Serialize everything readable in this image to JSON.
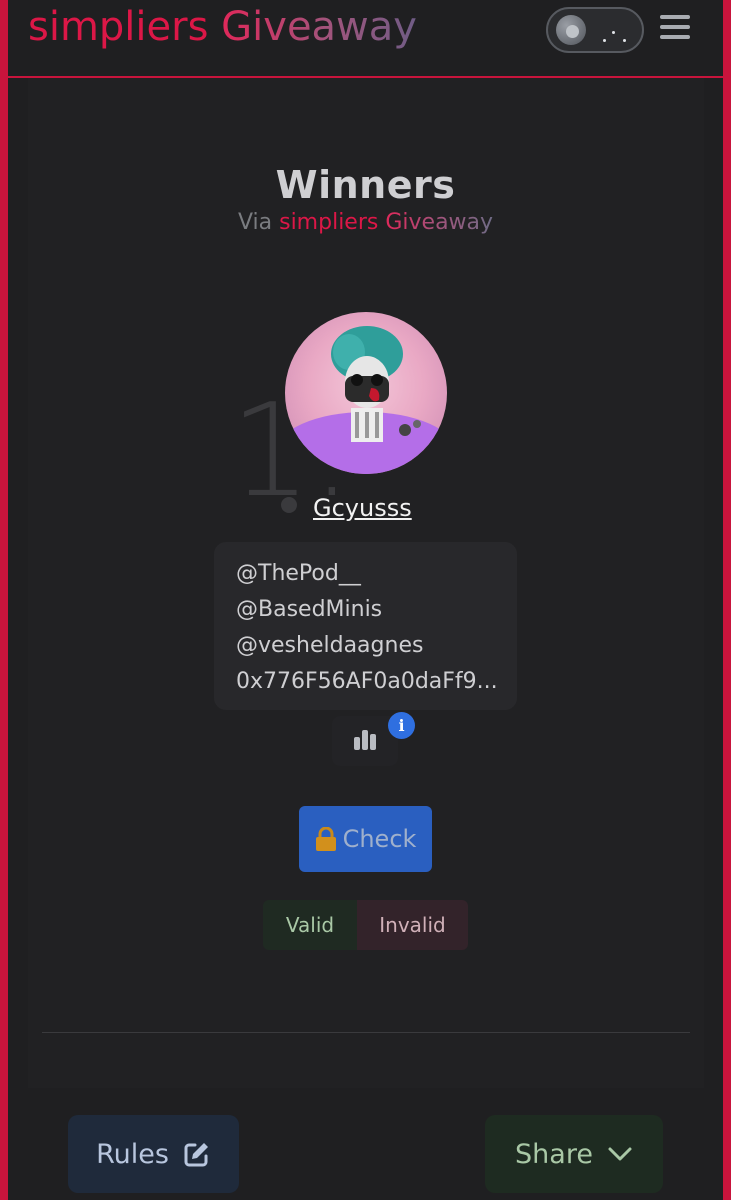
{
  "header": {
    "brand_part1": "simpliers",
    "brand_part2": "Giveaway",
    "theme_toggle_icon": "moon-toggle-icon",
    "menu_icon": "hamburger-menu-icon"
  },
  "main": {
    "title": "Winners",
    "via_prefix": "Via",
    "via_brand1": "simpliers",
    "via_brand2": "Giveaway"
  },
  "winners": [
    {
      "rank": "1.",
      "name": "Gcyusss",
      "entries": [
        "@ThePod__",
        "@BasedMinis",
        "@vesheldaagnes",
        "0x776F56AF0a0daFf9..."
      ]
    }
  ],
  "actions": {
    "stats_icon": "bar-chart-icon",
    "info_icon": "info-icon",
    "check_label": "Check",
    "check_icon": "lock-icon",
    "valid_label": "Valid",
    "invalid_label": "Invalid"
  },
  "footer": {
    "rules_label": "Rules",
    "rules_icon": "edit-icon",
    "share_label": "Share",
    "share_icon": "chevron-down-icon"
  },
  "colors": {
    "accent_red": "#dc1747",
    "frame_red": "#c8143c",
    "check_blue": "#2a5fc0",
    "info_blue": "#2f6fe0",
    "background": "#1f1f21"
  }
}
